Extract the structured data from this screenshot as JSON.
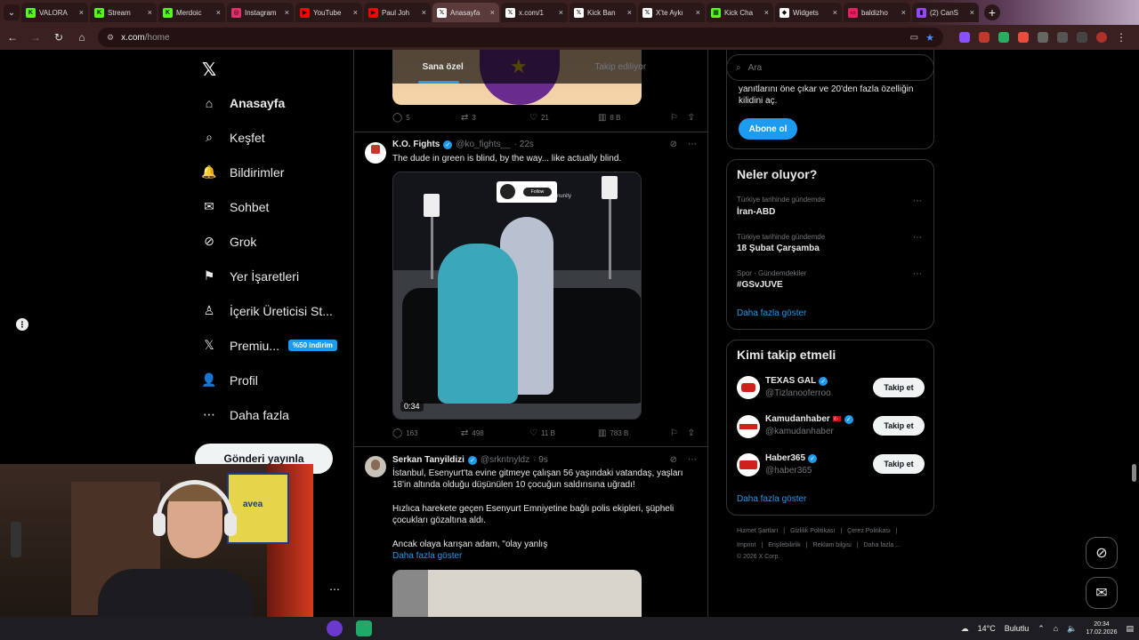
{
  "browser": {
    "tabs": [
      {
        "label": "VALORA",
        "color": "#53fc18",
        "glyph": "K"
      },
      {
        "label": "Stream",
        "color": "#53fc18",
        "glyph": "K"
      },
      {
        "label": "Merdoic",
        "color": "#53fc18",
        "glyph": "K"
      },
      {
        "label": "Instagram",
        "color": "#e1306c",
        "glyph": "◎"
      },
      {
        "label": "YouTube",
        "color": "#ff0000",
        "glyph": "▶"
      },
      {
        "label": "Paul Joh",
        "color": "#ff0000",
        "glyph": "▶"
      },
      {
        "label": "Anasayfa",
        "color": "#ffffff",
        "glyph": "𝕏",
        "active": true
      },
      {
        "label": "x.com/1",
        "color": "#ffffff",
        "glyph": "𝕏"
      },
      {
        "label": "Kick Ban",
        "color": "#ffffff",
        "glyph": "𝕏"
      },
      {
        "label": "X'te Aykı",
        "color": "#ffffff",
        "glyph": "𝕏"
      },
      {
        "label": "Kick Cha",
        "color": "#53fc18",
        "glyph": "▦"
      },
      {
        "label": "Widgets",
        "color": "#ffffff",
        "glyph": "◆"
      },
      {
        "label": "baldizho",
        "color": "#e91e63",
        "glyph": "▭"
      },
      {
        "label": "(2) CanS",
        "color": "#9146ff",
        "glyph": "▮"
      }
    ],
    "url_host": "x.com",
    "url_path": "/home"
  },
  "nav": {
    "items": [
      {
        "label": "Anasayfa",
        "icon": "⌂",
        "active": true
      },
      {
        "label": "Keşfet",
        "icon": "⌕"
      },
      {
        "label": "Bildirimler",
        "icon": "🔔"
      },
      {
        "label": "Sohbet",
        "icon": "✉"
      },
      {
        "label": "Grok",
        "icon": "⊘"
      },
      {
        "label": "Yer İşaretleri",
        "icon": "⚑"
      },
      {
        "label": "İçerik Üreticisi St...",
        "icon": "♙"
      },
      {
        "label": "Premiu...",
        "icon": "𝕏",
        "badge": "%50 indirim"
      },
      {
        "label": "Profil",
        "icon": "👤"
      },
      {
        "label": "Daha fazla",
        "icon": "⋯"
      }
    ],
    "post_button": "Gönderi yayınla"
  },
  "timeline": {
    "tabs": [
      "Sana özel",
      "Takip ediliyor"
    ],
    "prev_actions": {
      "replies": "5",
      "reposts": "3",
      "likes": "21",
      "views": "8 B"
    },
    "tweet1": {
      "name": "K.O. Fights",
      "handle": "@ko_fights__",
      "time": "· 22s",
      "text": "The dude in green is blind, by the way... like actually blind.",
      "video_overlay": "Follow",
      "video_overlay_suffix": "nunity",
      "duration": "0:34",
      "actions": {
        "replies": "163",
        "reposts": "498",
        "likes": "11 B",
        "views": "783 B"
      }
    },
    "tweet2": {
      "name": "Serkan Tanyildizi",
      "handle": "@srkntnyldz",
      "time": "· 9s",
      "p1": "İstanbul, Esenyurt'ta evine gitmeye çalışan 56 yaşındaki vatandaş, yaşları 18'in altında olduğu düşünülen 10 çocuğun saldırısına uğradı!",
      "p2": "Hızlıca harekete geçen Esenyurt Emniyetine bağlı polis ekipleri, şüpheli çocukları gözaltına aldı.",
      "p3": "Ancak olaya karışan adam, \"olay yanlış",
      "show_more": "Daha fazla göster"
    }
  },
  "right": {
    "search_placeholder": "Ara",
    "premium_text": "yanıtlarını öne çıkar ve 20'den fazla özelliğin kilidini aç.",
    "subscribe": "Abone ol",
    "trends_title": "Neler oluyor?",
    "trends": [
      {
        "meta": "Türkiye tarihinde gündemde",
        "name": "İran-ABD"
      },
      {
        "meta": "Türkiye tarihinde gündemde",
        "name": "18 Şubat Çarşamba"
      },
      {
        "meta": "Spor · Gündemdekiler",
        "name": "#GSvJUVE"
      }
    ],
    "trends_more": "Daha fazla göster",
    "who_title": "Kimi takip etmeli",
    "who": [
      {
        "name": "TEXAS GAL",
        "handle": "@Tizlanooferroo",
        "follow": "Takip et"
      },
      {
        "name": "Kamudanhaber",
        "flag": "🇹🇷",
        "handle": "@kamudanhaber",
        "follow": "Takip et"
      },
      {
        "name": "Haber365",
        "handle": "@haber365",
        "follow": "Takip et"
      }
    ],
    "who_more": "Daha fazla göster",
    "footer_row1": [
      "Hizmet Şartları",
      "|",
      "Gizlilik Politikası",
      "|",
      "Çerez Politikası",
      "|"
    ],
    "footer_row2": [
      "Imprint",
      "|",
      "Erişilebilirlik",
      "|",
      "Reklam bilgisi",
      "|",
      "Daha fazla ..."
    ],
    "copyright": "© 2026 X Corp."
  },
  "webcam": {
    "jersey_text": "avea"
  },
  "taskbar": {
    "weather_temp": "14°C",
    "weather_text": "Bulutlu",
    "time": "20:34",
    "date": "17.02.2026"
  }
}
